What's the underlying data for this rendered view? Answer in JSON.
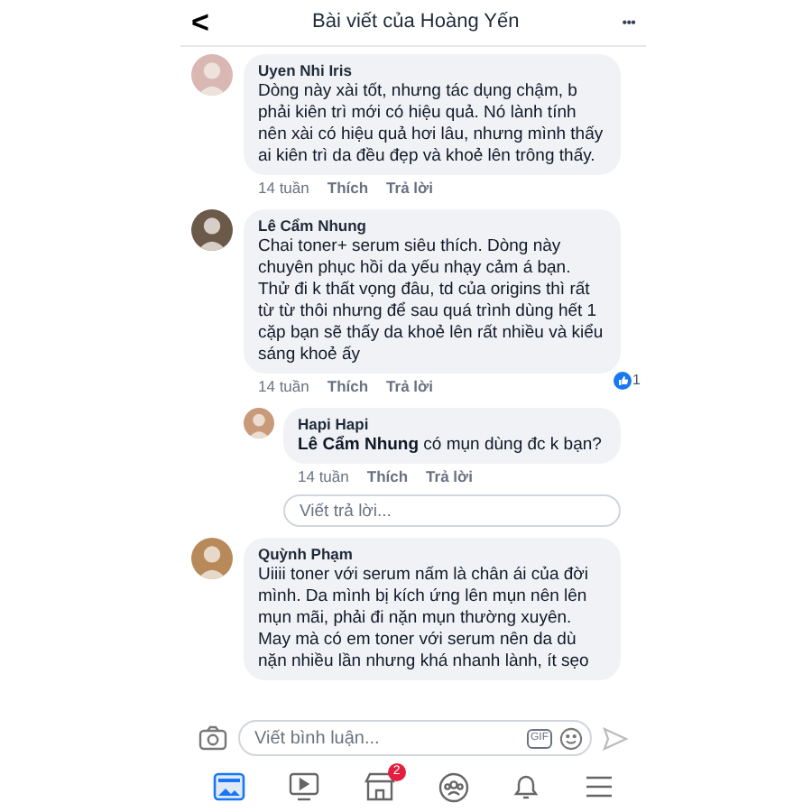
{
  "header": {
    "back": "<",
    "title": "Bài viết của Hoàng Yến",
    "more": "•••"
  },
  "comments": [
    {
      "author": "Uyen Nhi Iris",
      "text": "Dòng này xài tốt, nhưng tác dụng chậm, b phải kiên trì mới có hiệu quả. Nó lành tính nên xài có hiệu quả hơi lâu, nhưng mình thấy ai kiên trì da đều đẹp và khoẻ lên trông thấy.",
      "time": "14 tuần",
      "like": "Thích",
      "reply": "Trả lời"
    },
    {
      "author": "Lê Cẩm Nhung",
      "text": "Chai toner+ serum siêu thích. Dòng này chuyên phục hồi da yếu nhạy cảm á bạn. Thử đi k thất vọng đâu, td của origins thì rất từ từ thôi nhưng để sau quá trình dùng hết 1 cặp bạn sẽ thấy da khoẻ lên rất nhiều và kiểu sáng khoẻ ấy",
      "time": "14 tuần",
      "like": "Thích",
      "reply": "Trả lời",
      "reactions": "1",
      "replies": [
        {
          "author": "Hapi Hapi",
          "text": "**Lê Cẩm Nhung** có mụn dùng đc k bạn?",
          "time": "14 tuần",
          "like": "Thích",
          "reply": "Trả lời"
        }
      ],
      "reply_field": {
        "placeholder": "Viết trả lời..."
      }
    },
    {
      "author": "Quỳnh Phạm",
      "text": "Uiiii toner với serum nấm là chân ái của đời mình. Da mình bị kích ứng lên mụn nên lên mụn mãi, phải đi nặn mụn thường xuyên. May mà có em toner với serum nên da dù nặn nhiều lần nhưng khá nhanh lành, ít sẹo"
    }
  ],
  "composer": {
    "placeholder": "Viết bình luận...",
    "gif": "GIF"
  },
  "nav": [
    {
      "kind": "feed",
      "selected": true
    },
    {
      "kind": "watch",
      "selected": false
    },
    {
      "kind": "market",
      "selected": false,
      "badge": "2"
    },
    {
      "kind": "groups",
      "selected": false
    },
    {
      "kind": "bell",
      "selected": false
    },
    {
      "kind": "menu",
      "selected": false
    }
  ]
}
